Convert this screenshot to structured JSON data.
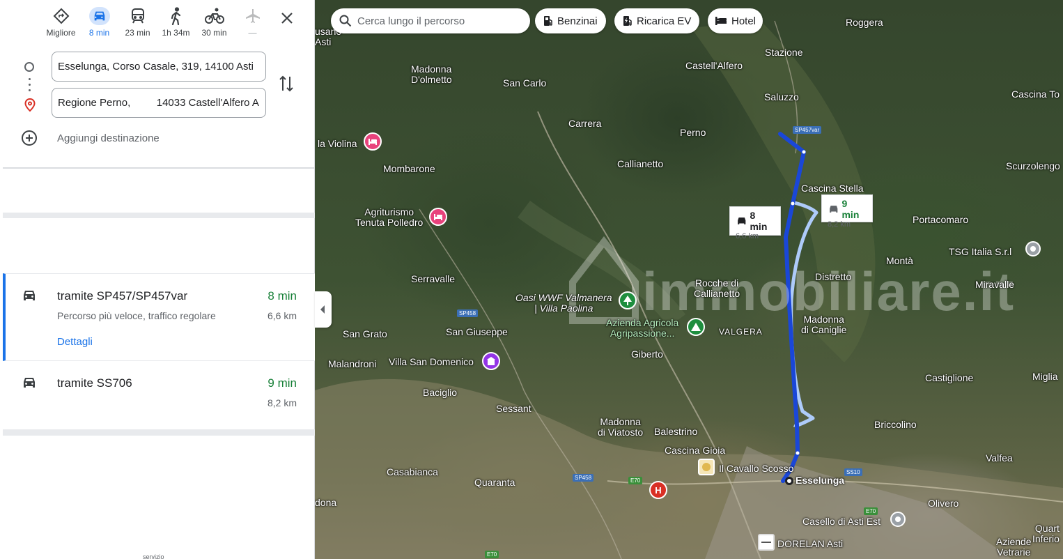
{
  "travel_modes": [
    {
      "name": "best",
      "label": "Migliore",
      "icon": "best-route-icon"
    },
    {
      "name": "car",
      "label": "8 min",
      "icon": "car-icon",
      "active": true
    },
    {
      "name": "transit",
      "label": "23 min",
      "icon": "train-icon"
    },
    {
      "name": "walk",
      "label": "1h 34m",
      "icon": "walk-icon"
    },
    {
      "name": "bike",
      "label": "30 min",
      "icon": "bike-icon"
    },
    {
      "name": "flight",
      "label": "—",
      "icon": "plane-icon",
      "disabled": true
    }
  ],
  "directions": {
    "origin": "Esselunga, Corso Casale, 319, 14100 Asti",
    "destination": "Regione Perno,         14033 Castell'Alfero A",
    "add_destination": "Aggiungi destinazione"
  },
  "routes": [
    {
      "title": "tramite SP457/SP457var",
      "subtitle": "Percorso più veloce, traffico regolare",
      "time": "8 min",
      "distance": "6,6 km",
      "details": "Dettagli",
      "selected": true
    },
    {
      "title": "tramite SS706",
      "time": "9 min",
      "distance": "8,2 km"
    }
  ],
  "bottom_text": "servizio",
  "map": {
    "search_placeholder": "Cerca lungo il percorso",
    "chips": [
      "Benzinai",
      "Ricarica EV",
      "Hotel"
    ],
    "route_card_main": {
      "time": "8 min",
      "distance": "6,6 km"
    },
    "route_card_alt": {
      "time": "9 min",
      "distance": "8,2 km"
    },
    "watermark": "immobiliare.it",
    "places": [
      {
        "text": "usano",
        "sub": "Asti",
        "name": "place-usano-asti"
      },
      {
        "text": "Madonna",
        "sub": "D'olmetto",
        "name": "place-madonna-dolmetto"
      },
      {
        "text": "San Carlo",
        "name": "place-san-carlo"
      },
      {
        "text": "Castell'Alfero",
        "name": "place-castell-alfero"
      },
      {
        "text": "Stazione",
        "name": "place-stazione"
      },
      {
        "text": "Roggera",
        "name": "place-roggera"
      },
      {
        "text": "Saluzzo",
        "name": "place-saluzzo"
      },
      {
        "text": "Cascina To",
        "name": "place-cascina-to"
      },
      {
        "text": "Carrera",
        "name": "place-carrera"
      },
      {
        "text": "Perno",
        "name": "place-perno"
      },
      {
        "text": "la Violina",
        "name": "place-la-violina"
      },
      {
        "text": "Mombarone",
        "name": "place-mombarone"
      },
      {
        "text": "Callianetto",
        "name": "place-callianetto"
      },
      {
        "text": "Scurzolengo",
        "name": "place-scurzolengo"
      },
      {
        "text": "Cascina Stella",
        "name": "place-cascina-stella"
      },
      {
        "text": "Agriturismo",
        "sub": "Tenuta Polledro",
        "name": "place-agriturismo"
      },
      {
        "text": "Portacomaro",
        "name": "place-portacomaro"
      },
      {
        "text": "TSG Italia S.r.l",
        "name": "place-tsg-italia"
      },
      {
        "text": "Montà",
        "name": "place-monta"
      },
      {
        "text": "Distretto",
        "name": "place-distretto"
      },
      {
        "text": "Miravalle",
        "name": "place-miravalle"
      },
      {
        "text": "Serravalle",
        "name": "place-serravalle"
      },
      {
        "text": "Rocche di",
        "sub": "Callianetto",
        "name": "place-rocche"
      },
      {
        "text": "Oasi WWF Valmanera",
        "sub": "| Villa Paolina",
        "name": "place-oasi-wwf"
      },
      {
        "text": "Azienda Agricola",
        "sub": "Agripassione...",
        "name": "place-azienda-agricola"
      },
      {
        "text": "VALGERA",
        "name": "place-valgera"
      },
      {
        "text": "Madonna",
        "sub": "di Caniglie",
        "name": "place-madonna-caniglie"
      },
      {
        "text": "San Grato",
        "name": "place-san-grato"
      },
      {
        "text": "San Giuseppe",
        "name": "place-san-giuseppe"
      },
      {
        "text": "Giberto",
        "name": "place-giberto"
      },
      {
        "text": "Malandroni",
        "name": "place-malandroni"
      },
      {
        "text": "Villa San Domenico",
        "name": "place-villa-san-domenico"
      },
      {
        "text": "Castiglione",
        "name": "place-castiglione"
      },
      {
        "text": "Miglia",
        "name": "place-miglia"
      },
      {
        "text": "Baciglio",
        "name": "place-baciglio"
      },
      {
        "text": "Sessant",
        "name": "place-sessant"
      },
      {
        "text": "Madonna",
        "sub": "di Viatosto",
        "name": "place-madonna-viatosto"
      },
      {
        "text": "Balestrino",
        "name": "place-balestrino"
      },
      {
        "text": "Briccolino",
        "name": "place-briccolino"
      },
      {
        "text": "Cascina Gioia",
        "name": "place-cascina-gioia"
      },
      {
        "text": "Valfea",
        "name": "place-valfea"
      },
      {
        "text": "Il Cavallo Scosso",
        "name": "place-il-cavallo-scosso"
      },
      {
        "text": "Esselunga",
        "name": "place-esselunga"
      },
      {
        "text": "Casabianca",
        "name": "place-casabianca"
      },
      {
        "text": "Quaranta",
        "name": "place-quaranta"
      },
      {
        "text": "Olivero",
        "name": "place-olivero"
      },
      {
        "text": "dona",
        "name": "place-dona"
      },
      {
        "text": "Casello di Asti Est",
        "name": "place-casello-asti-est"
      },
      {
        "text": "Quart",
        "sub": "Inferio",
        "name": "place-quarto-inferiore"
      },
      {
        "text": "DORELAN Asti",
        "name": "place-dorelan-asti"
      },
      {
        "text": "Aziende",
        "sub": "Vetrarie",
        "name": "place-aziende-vetrarie"
      }
    ],
    "road_badges": [
      "SP457var",
      "SP458",
      "SP458",
      "E70",
      "SS10",
      "E70",
      "E70"
    ]
  }
}
